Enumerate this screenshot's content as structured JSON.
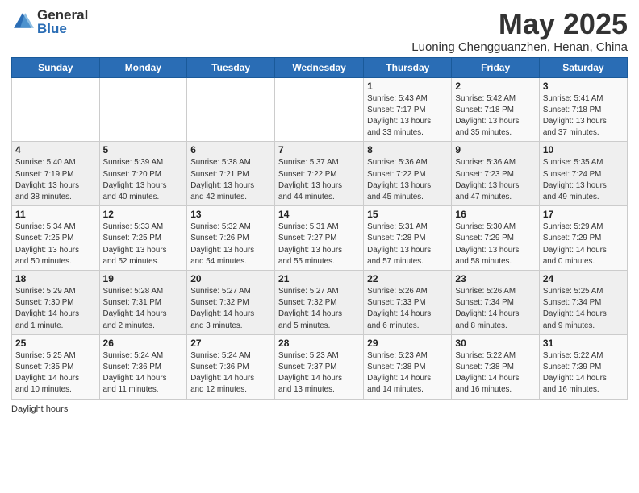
{
  "header": {
    "logo_general": "General",
    "logo_blue": "Blue",
    "month_title": "May 2025",
    "subtitle": "Luoning Chengguanzhen, Henan, China"
  },
  "weekdays": [
    "Sunday",
    "Monday",
    "Tuesday",
    "Wednesday",
    "Thursday",
    "Friday",
    "Saturday"
  ],
  "weeks": [
    [
      {
        "day": "",
        "info": ""
      },
      {
        "day": "",
        "info": ""
      },
      {
        "day": "",
        "info": ""
      },
      {
        "day": "",
        "info": ""
      },
      {
        "day": "1",
        "info": "Sunrise: 5:43 AM\nSunset: 7:17 PM\nDaylight: 13 hours\nand 33 minutes."
      },
      {
        "day": "2",
        "info": "Sunrise: 5:42 AM\nSunset: 7:18 PM\nDaylight: 13 hours\nand 35 minutes."
      },
      {
        "day": "3",
        "info": "Sunrise: 5:41 AM\nSunset: 7:18 PM\nDaylight: 13 hours\nand 37 minutes."
      }
    ],
    [
      {
        "day": "4",
        "info": "Sunrise: 5:40 AM\nSunset: 7:19 PM\nDaylight: 13 hours\nand 38 minutes."
      },
      {
        "day": "5",
        "info": "Sunrise: 5:39 AM\nSunset: 7:20 PM\nDaylight: 13 hours\nand 40 minutes."
      },
      {
        "day": "6",
        "info": "Sunrise: 5:38 AM\nSunset: 7:21 PM\nDaylight: 13 hours\nand 42 minutes."
      },
      {
        "day": "7",
        "info": "Sunrise: 5:37 AM\nSunset: 7:22 PM\nDaylight: 13 hours\nand 44 minutes."
      },
      {
        "day": "8",
        "info": "Sunrise: 5:36 AM\nSunset: 7:22 PM\nDaylight: 13 hours\nand 45 minutes."
      },
      {
        "day": "9",
        "info": "Sunrise: 5:36 AM\nSunset: 7:23 PM\nDaylight: 13 hours\nand 47 minutes."
      },
      {
        "day": "10",
        "info": "Sunrise: 5:35 AM\nSunset: 7:24 PM\nDaylight: 13 hours\nand 49 minutes."
      }
    ],
    [
      {
        "day": "11",
        "info": "Sunrise: 5:34 AM\nSunset: 7:25 PM\nDaylight: 13 hours\nand 50 minutes."
      },
      {
        "day": "12",
        "info": "Sunrise: 5:33 AM\nSunset: 7:25 PM\nDaylight: 13 hours\nand 52 minutes."
      },
      {
        "day": "13",
        "info": "Sunrise: 5:32 AM\nSunset: 7:26 PM\nDaylight: 13 hours\nand 54 minutes."
      },
      {
        "day": "14",
        "info": "Sunrise: 5:31 AM\nSunset: 7:27 PM\nDaylight: 13 hours\nand 55 minutes."
      },
      {
        "day": "15",
        "info": "Sunrise: 5:31 AM\nSunset: 7:28 PM\nDaylight: 13 hours\nand 57 minutes."
      },
      {
        "day": "16",
        "info": "Sunrise: 5:30 AM\nSunset: 7:29 PM\nDaylight: 13 hours\nand 58 minutes."
      },
      {
        "day": "17",
        "info": "Sunrise: 5:29 AM\nSunset: 7:29 PM\nDaylight: 14 hours\nand 0 minutes."
      }
    ],
    [
      {
        "day": "18",
        "info": "Sunrise: 5:29 AM\nSunset: 7:30 PM\nDaylight: 14 hours\nand 1 minute."
      },
      {
        "day": "19",
        "info": "Sunrise: 5:28 AM\nSunset: 7:31 PM\nDaylight: 14 hours\nand 2 minutes."
      },
      {
        "day": "20",
        "info": "Sunrise: 5:27 AM\nSunset: 7:32 PM\nDaylight: 14 hours\nand 3 minutes."
      },
      {
        "day": "21",
        "info": "Sunrise: 5:27 AM\nSunset: 7:32 PM\nDaylight: 14 hours\nand 5 minutes."
      },
      {
        "day": "22",
        "info": "Sunrise: 5:26 AM\nSunset: 7:33 PM\nDaylight: 14 hours\nand 6 minutes."
      },
      {
        "day": "23",
        "info": "Sunrise: 5:26 AM\nSunset: 7:34 PM\nDaylight: 14 hours\nand 8 minutes."
      },
      {
        "day": "24",
        "info": "Sunrise: 5:25 AM\nSunset: 7:34 PM\nDaylight: 14 hours\nand 9 minutes."
      }
    ],
    [
      {
        "day": "25",
        "info": "Sunrise: 5:25 AM\nSunset: 7:35 PM\nDaylight: 14 hours\nand 10 minutes."
      },
      {
        "day": "26",
        "info": "Sunrise: 5:24 AM\nSunset: 7:36 PM\nDaylight: 14 hours\nand 11 minutes."
      },
      {
        "day": "27",
        "info": "Sunrise: 5:24 AM\nSunset: 7:36 PM\nDaylight: 14 hours\nand 12 minutes."
      },
      {
        "day": "28",
        "info": "Sunrise: 5:23 AM\nSunset: 7:37 PM\nDaylight: 14 hours\nand 13 minutes."
      },
      {
        "day": "29",
        "info": "Sunrise: 5:23 AM\nSunset: 7:38 PM\nDaylight: 14 hours\nand 14 minutes."
      },
      {
        "day": "30",
        "info": "Sunrise: 5:22 AM\nSunset: 7:38 PM\nDaylight: 14 hours\nand 16 minutes."
      },
      {
        "day": "31",
        "info": "Sunrise: 5:22 AM\nSunset: 7:39 PM\nDaylight: 14 hours\nand 16 minutes."
      }
    ]
  ],
  "footer": {
    "daylight_hours": "Daylight hours"
  }
}
